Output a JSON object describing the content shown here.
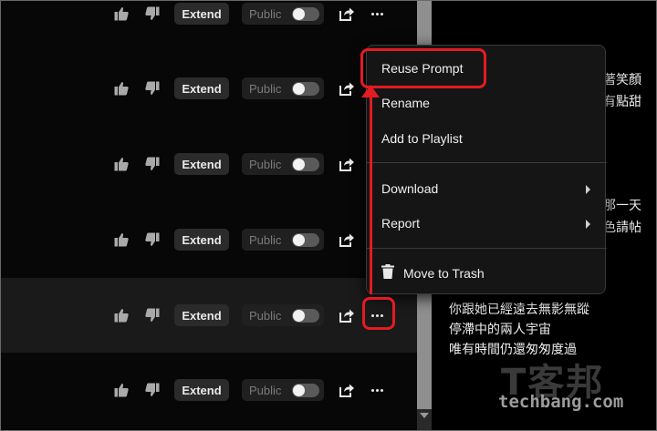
{
  "rows": [
    {
      "extend": "Extend",
      "public": "Public"
    },
    {
      "extend": "Extend",
      "public": "Public"
    },
    {
      "extend": "Extend",
      "public": "Public"
    },
    {
      "extend": "Extend",
      "public": "Public"
    },
    {
      "extend": "Extend",
      "public": "Public"
    },
    {
      "extend": "Extend",
      "public": "Public"
    }
  ],
  "menu": {
    "reuse_prompt": "Reuse Prompt",
    "rename": "Rename",
    "add_to_playlist": "Add to Playlist",
    "download": "Download",
    "report": "Report",
    "move_to_trash": "Move to Trash"
  },
  "right_partial": {
    "line1": "著笑顏",
    "line2": "有點甜",
    "line3": "那一天",
    "line4": "色請帖"
  },
  "lyrics": [
    "你跟她已經遠去無影無蹤",
    "停滯中的兩人宇宙",
    "唯有時間仍還匆匆度過"
  ],
  "watermark": {
    "logo_text": "T客邦",
    "domain": "techbang.com"
  },
  "colors": {
    "annotation_red": "#e31b23",
    "menu_bg": "#151515",
    "extend_bg": "#2b2b2b"
  }
}
